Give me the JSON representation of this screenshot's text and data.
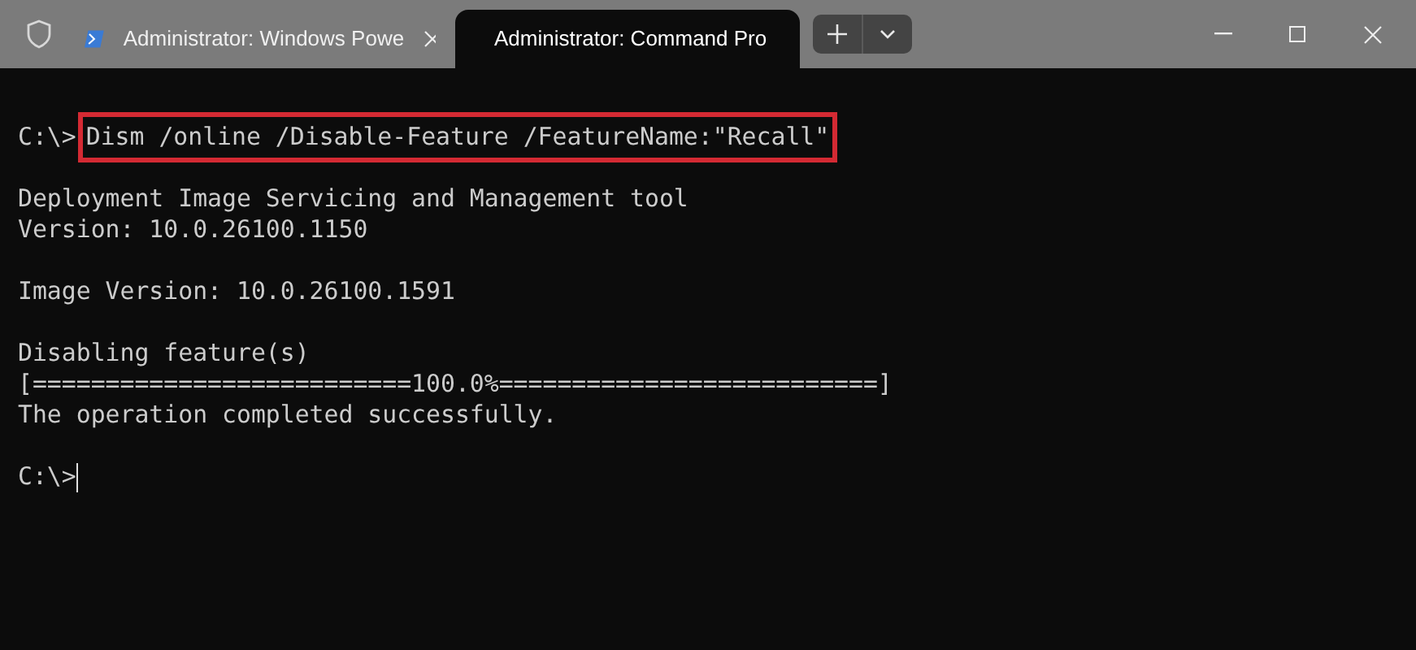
{
  "tabs": [
    {
      "label": "Administrator: Windows Powe",
      "selected": false
    },
    {
      "label": "Administrator: Command Pro",
      "selected": true
    }
  ],
  "terminal": {
    "lines": [
      {
        "kind": "blank"
      },
      {
        "kind": "input",
        "prompt": "C:\\>",
        "command": "Dism /online /Disable-Feature /FeatureName:\"Recall\"",
        "highlighted": true
      },
      {
        "kind": "blank"
      },
      {
        "kind": "output",
        "text": "Deployment Image Servicing and Management tool"
      },
      {
        "kind": "output",
        "text": "Version: 10.0.26100.1150"
      },
      {
        "kind": "blank"
      },
      {
        "kind": "output",
        "text": "Image Version: 10.0.26100.1591"
      },
      {
        "kind": "blank"
      },
      {
        "kind": "output",
        "text": "Disabling feature(s)"
      },
      {
        "kind": "output",
        "text": "[==========================100.0%==========================]"
      },
      {
        "kind": "output",
        "text": "The operation completed successfully."
      },
      {
        "kind": "blank"
      },
      {
        "kind": "input",
        "prompt": "C:\\>",
        "cursor": true
      }
    ]
  }
}
